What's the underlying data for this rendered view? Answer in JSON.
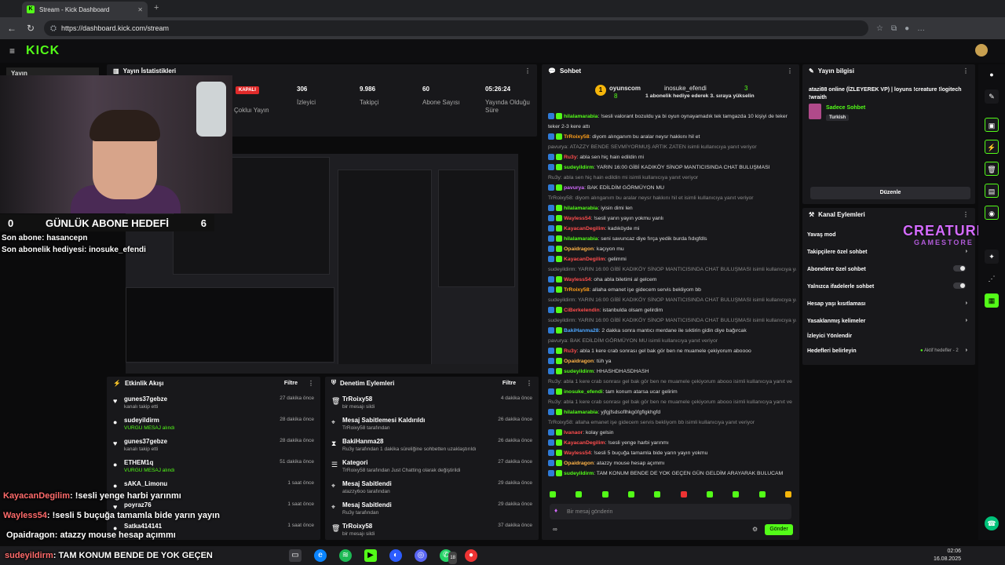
{
  "browser": {
    "tab_title": "Stream - Kick Dashboard",
    "url": "https://dashboard.kick.com/stream"
  },
  "kick": {
    "logo": "KICK",
    "sidebar_peek": "Yayın"
  },
  "stats": {
    "title": "Yayın İstatistikleri",
    "badge": "KAPALI",
    "items": [
      {
        "label": "Çokluı Yayın",
        "value": ""
      },
      {
        "label": "İzleyici",
        "value": "306"
      },
      {
        "label": "Takipçi",
        "value": "9.986"
      },
      {
        "label": "Abone Sayısı",
        "value": "60"
      },
      {
        "label": "Yayında Olduğu Süre",
        "value": "05:26:24"
      }
    ]
  },
  "overlay": {
    "goal_left": "0",
    "goal_label": "GÜNLÜK ABONE HEDEFİ",
    "goal_right": "6",
    "last_sub": "Son abone: hasancepn",
    "last_gift": "Son abonelik hediyesi: inosuke_efendi",
    "chat_lines": [
      {
        "user": "KayacanDegilim",
        "text": ": !sesli yenge harbi yarınmı"
      },
      {
        "user": "Wayless54",
        "text": ": !sesli 5 buçuğa tamamla bide yarın yayın"
      },
      {
        "user": "Opaidragon",
        "text": ": atazzy mouse hesap açımmı"
      },
      {
        "user": "sudeyildirm",
        "text": ": TAM KONUM BENDE DE YOK GEÇEN"
      }
    ]
  },
  "activity": {
    "title": "Etkinlik Akışı",
    "filter": "Filtre",
    "rows": [
      {
        "name": "gunes37gebze",
        "sub": "kanalı takip etti",
        "time": "27 dakika önce"
      },
      {
        "name": "sudeyildirm",
        "sub": "VURGU MESAJ alındı",
        "time": "28 dakika önce"
      },
      {
        "name": "gunes37gebze",
        "sub": "kanalı takip etti",
        "time": "28 dakika önce"
      },
      {
        "name": "ETHEM1q",
        "sub": "VURGU MESAJ alındı",
        "time": "51 dakika önce"
      },
      {
        "name": "sAKA_Limonu",
        "sub": "",
        "time": "1 saat önce"
      },
      {
        "name": "poyraz76",
        "sub": "",
        "time": "1 saat önce"
      },
      {
        "name": "Satka414141",
        "sub": "",
        "time": "1 saat önce"
      }
    ]
  },
  "moderation": {
    "title": "Denetim Eylemleri",
    "filter": "Filtre",
    "rows": [
      {
        "name": "TrRoixy58",
        "sub": "bir mesajı sildi",
        "time": "4 dakika önce"
      },
      {
        "name": "Mesaj Sabitlemesi Kaldırıldı",
        "sub": "TrRoixy58 tarafından",
        "time": "26 dakika önce"
      },
      {
        "name": "BakiHanma28",
        "sub": "Ru3y tarafından 1 dakika süreliğine sohbetten uzaklaştırıldı",
        "time": "26 dakika önce"
      },
      {
        "name": "Kategori",
        "sub": "TrRoixy58 tarafından Just Chatting olarak değiştirildi",
        "time": "27 dakika önce"
      },
      {
        "name": "Mesaj Sabitlendi",
        "sub": "atazzy6oo tarafından",
        "time": "29 dakika önce"
      },
      {
        "name": "Mesaj Sabitlendi",
        "sub": "Ru3y tarafından",
        "time": "29 dakika önce"
      },
      {
        "name": "TrRoixy58",
        "sub": "bir mesajı sildi",
        "time": "37 dakika önce"
      }
    ]
  },
  "chat": {
    "title": "Sohbet",
    "top_user": "oyunscom",
    "top_count": "8",
    "gift_user": "inosuke_efendi",
    "gift_count": "3",
    "gift_text": "1 abonelik hediye ederek 3. sıraya yükselin",
    "input_placeholder": "Bir mesaj gönderin",
    "send": "Gönder",
    "messages": [
      {
        "user": "hilalamarabia",
        "text": ": !sesli valorant bozuldu ya bi oyun oynayamadık tek tamgazda 10 kişiyi de teker",
        "color": "#53fc18"
      },
      {
        "user": "",
        "text": "teker 2-3 kere attı",
        "color": ""
      },
      {
        "user": "TrRoixy58",
        "text": ": diyom alınganım bu aralar neysr hakkını hil et",
        "color": "#ff9f1a"
      },
      {
        "user": "",
        "text": "pavurya: ATAZZY BENDE SEVMİYORMUŞ ARTIK ZATEN isimli kullanıcıya yanıt veriyor",
        "color": "sys"
      },
      {
        "user": "Ru3y",
        "text": ": abla sen hiç hain edildin mi",
        "color": "#ff4d4d"
      },
      {
        "user": "sudeyildirm",
        "text": ": YARIN 16:00 GİBİ KADIKÖY SİNOP MANTICISINDA CHAT BULUŞMASI",
        "color": "#53fc18"
      },
      {
        "user": "",
        "text": "Ru3y: abla sen hiç hain edildin mi isimli kullanıcıya yanıt veriyor",
        "color": "sys"
      },
      {
        "user": "pavurya",
        "text": ": BAK EDİLDİM GÖRMÜYON MU",
        "color": "#d46bff"
      },
      {
        "user": "",
        "text": "TrRoixy58: diyom alınganım bu aralar neysr hakkını hil et isimli kullanıcıya yanıt veriyor",
        "color": "sys"
      },
      {
        "user": "hilalamarabia",
        "text": ": iyisin dimi len",
        "color": "#53fc18"
      },
      {
        "user": "Wayless54",
        "text": ": !sesli yarın yayın yokmu yanlı",
        "color": "#ff4d4d"
      },
      {
        "user": "KayacanDegilim",
        "text": ": kadıköyde mi",
        "color": "#ff4d4d"
      },
      {
        "user": "hilalamarabia",
        "text": ": seni savuncaz diye fırça yedik burda fıdıgfdls",
        "color": "#53fc18"
      },
      {
        "user": "Opaidragon",
        "text": ": kaçıyon mu",
        "color": "#ffb347"
      },
      {
        "user": "KayacanDegilim",
        "text": ": gelimmi",
        "color": "#ff4d4d"
      },
      {
        "user": "",
        "text": "sudeyildirm: YARIN 16:00 GİBİ KADIKÖY SİNOP MANTICISINDA CHAT BULUŞMASI isimli kullanıcıya yan",
        "color": "sys"
      },
      {
        "user": "Wayless54",
        "text": ": oha abla biletimi al gelcem",
        "color": "#ff4d4d"
      },
      {
        "user": "TrRoixy58",
        "text": ": allaha emanet işe gidecem servis bekliyom bb",
        "color": "#ff9f1a"
      },
      {
        "user": "",
        "text": "sudeyildirm: YARIN 16:00 GİBİ KADIKÖY SİNOP MANTICISINDA CHAT BULUŞMASI isimli kullanıcıya yan",
        "color": "sys"
      },
      {
        "user": "CiBerkelendin",
        "text": ": istanbulda olsam gelirdim",
        "color": "#ff4d4d"
      },
      {
        "user": "",
        "text": "sudeyildirm: YARIN 16:00 GİBİ KADIKÖY SİNOP MANTICISINDA CHAT BULUŞMASI isimli kullanıcıya yan",
        "color": "sys"
      },
      {
        "user": "BakiHanma28",
        "text": ": 2 dakka sonra mantıcı merdane ile sıktirin gidin diye bağırcak",
        "color": "#4da6ff"
      },
      {
        "user": "",
        "text": "pavurya: BAK EDİLDİM GÖRMÜYON MU isimli kullanıcıya yanıt veriyor",
        "color": "sys"
      },
      {
        "user": "Ru3y",
        "text": ": abla 1 kere crab sonrası gel bak gör ben ne muamele çekiyorum aboooo",
        "color": "#ff4d4d"
      },
      {
        "user": "Opaidragon",
        "text": ": tüh ya",
        "color": "#ffb347"
      },
      {
        "user": "sudeyildirm",
        "text": ": HHASHDHASDHASH",
        "color": "#53fc18"
      },
      {
        "user": "",
        "text": "Ru3y: abla 1 kere crab sonrası gel bak gör ben ne muamele çekiyorum abooo isimli kullanıcıya yanıt ve",
        "color": "sys"
      },
      {
        "user": "inosuke_efendi",
        "text": ": tam konum atarsa ucar gelirim",
        "color": "#53fc18"
      },
      {
        "user": "",
        "text": "Ru3y: abla 1 kere crab sonrası gel bak gör ben ne muamele çekiyorum abooo isimli kullanıcıya yanıt ve",
        "color": "sys"
      },
      {
        "user": "hilalamarabia",
        "text": ": yjfgjfsdsoflhkgöfgflgkhgfd",
        "color": "#53fc18"
      },
      {
        "user": "",
        "text": "TrRoixy58: allaha emanet işe gidecem servis bekliyom bb isimli kullanıcıya yanıt veriyor",
        "color": "sys"
      },
      {
        "user": "Ivanaor",
        "text": ": kolay gelsin",
        "color": "#ff4d4d"
      },
      {
        "user": "KayacanDegilim",
        "text": ": !sesli yenge harbi yarınmı",
        "color": "#ff4d4d"
      },
      {
        "user": "Wayless54",
        "text": ": !sesli 5 buçuğa tamamla bide yarın yayın yokmu",
        "color": "#ff4d4d"
      },
      {
        "user": "Opaidragon",
        "text": ": atazzy mouse hesap açımmı",
        "color": "#ffb347"
      },
      {
        "user": "sudeyildirm",
        "text": ": TAM KONUM BENDE DE YOK GEÇEN GÜN GELDİM ARAYARAK BULUCAM",
        "color": "#53fc18"
      }
    ]
  },
  "info": {
    "title": "Yayın bilgisi",
    "stream_title": "atazi88 online (İZLEYEREK VP) | loyuns !creature !logitech !wraith",
    "category": "Sadece Sohbet",
    "tag": "Turkish",
    "edit": "Düzenle"
  },
  "channel_actions": {
    "title": "Kanal Eylemleri",
    "items": [
      {
        "label": "Yavaş mod",
        "kind": "none"
      },
      {
        "label": "Takipçilere özel sohbet",
        "kind": "chevron"
      },
      {
        "label": "Abonelere özel sohbet",
        "kind": "toggle"
      },
      {
        "label": "Yalnızca ifadelerle sohbet",
        "kind": "toggle"
      },
      {
        "label": "Hesap yaşı kısıtlaması",
        "kind": "chevron"
      },
      {
        "label": "Yasaklanmış kelimeler",
        "kind": "chevron"
      },
      {
        "label": "İzleyici Yönlendir",
        "kind": "none"
      },
      {
        "label": "Hedefleri belirleyin",
        "kind": "chevron"
      }
    ],
    "goals_status": "Aktif hedefler - 2"
  },
  "watermark": {
    "line1": "CREATURE",
    "line2": "GAMESTORE"
  },
  "taskbar": {
    "time": "02:06",
    "date": "16.08.2025",
    "badge": "18"
  }
}
